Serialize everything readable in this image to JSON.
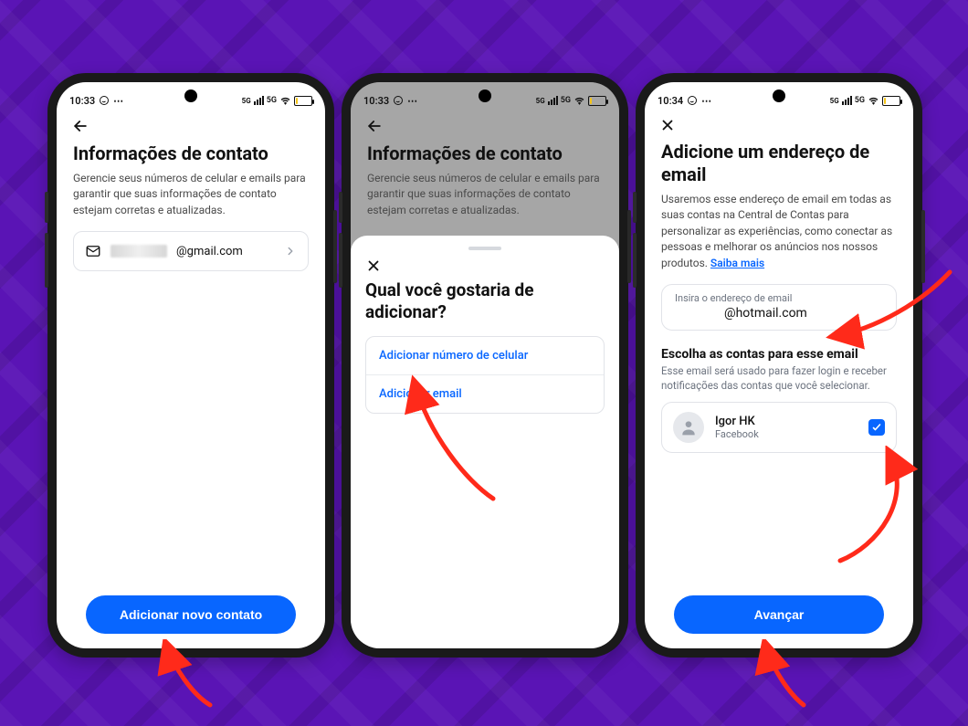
{
  "phones": {
    "p1": {
      "status": {
        "time": "10:33",
        "net": "5G",
        "battery_pct": 7
      },
      "title": "Informações de contato",
      "desc": "Gerencie seus números de celular e emails para garantir que suas informações de contato estejam corretas e atualizadas.",
      "contact_suffix": "@gmail.com",
      "primary_btn": "Adicionar novo contato"
    },
    "p2": {
      "status": {
        "time": "10:33",
        "net": "5G",
        "battery_pct": 7
      },
      "bg_title": "Informações de contato",
      "bg_desc": "Gerencie seus números de celular e emails para garantir que suas informações de contato estejam corretas e atualizadas.",
      "sheet_title": "Qual você gostaria de adicionar?",
      "option_phone": "Adicionar número de celular",
      "option_email": "Adicionar email"
    },
    "p3": {
      "status": {
        "time": "10:34",
        "net": "5G",
        "battery_pct": 7
      },
      "title": "Adicione um endereço de email",
      "desc_prefix": "Usaremos esse endereço de email em todas as suas contas na Central de Contas para personalizar as experiências, como conectar as pessoas e melhorar os anúncios nos nossos produtos. ",
      "desc_link": "Saiba mais",
      "input_label": "Insira o endereço de email",
      "input_suffix": "@hotmail.com",
      "choose_heading": "Escolha as contas para esse email",
      "choose_desc": "Esse email será usado para fazer login e receber notificações das contas que você selecionar.",
      "account_name": "Igor HK",
      "account_sub": "Facebook",
      "primary_btn": "Avançar"
    }
  },
  "icons": {
    "whatsapp": "whatsapp-icon",
    "dots": "more-icon",
    "signal": "signal-icon",
    "wifi": "wifi-icon",
    "volte": "volte-icon",
    "battery": "battery-icon",
    "back": "back-arrow-icon",
    "close": "close-icon",
    "mail": "mail-icon",
    "chevron": "chevron-right-icon",
    "check": "check-icon",
    "person": "person-icon"
  }
}
